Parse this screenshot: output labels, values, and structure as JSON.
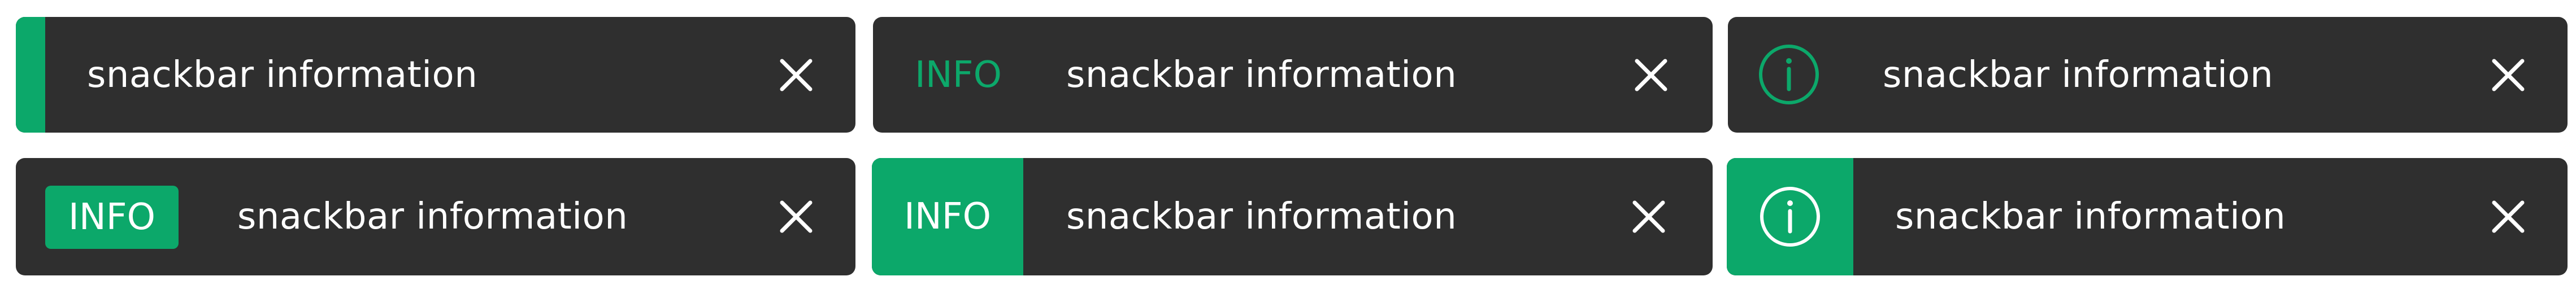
{
  "colors": {
    "bar_background": "#2f2f2f",
    "accent": "#0ca86a",
    "text": "#ffffff"
  },
  "snackbars": [
    {
      "variant": "left-stripe",
      "message": "snackbar information",
      "close_icon": "close-icon"
    },
    {
      "variant": "inline-tag-text",
      "tag": "INFO",
      "message": "snackbar information",
      "close_icon": "close-icon"
    },
    {
      "variant": "inline-icon",
      "icon": "info-circle-icon",
      "message": "snackbar information",
      "close_icon": "close-icon"
    },
    {
      "variant": "filled-tag-pill",
      "tag": "INFO",
      "message": "snackbar information",
      "close_icon": "close-icon"
    },
    {
      "variant": "filled-tag-block",
      "tag": "INFO",
      "message": "snackbar information",
      "close_icon": "close-icon"
    },
    {
      "variant": "filled-icon-block",
      "icon": "info-circle-icon",
      "message": "snackbar information",
      "close_icon": "close-icon"
    }
  ]
}
